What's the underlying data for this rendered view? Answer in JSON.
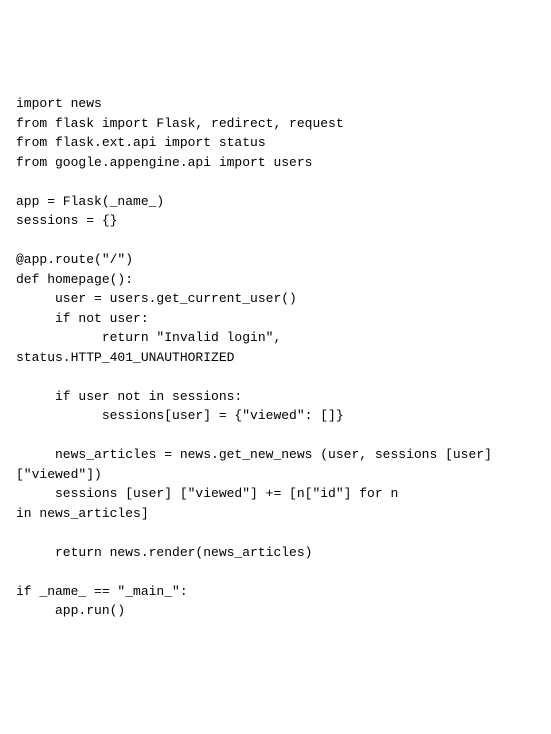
{
  "code": {
    "lines": [
      "import news",
      "from flask import Flask, redirect, request",
      "from flask.ext.api import status",
      "from google.appengine.api import users",
      "",
      "app = Flask(_name_)",
      "sessions = {}",
      "",
      "@app.route(\"/\")",
      "def homepage():",
      "     user = users.get_current_user()",
      "     if not user:",
      "           return \"Invalid login\",",
      "status.HTTP_401_UNAUTHORIZED",
      "",
      "     if user not in sessions:",
      "           sessions[user] = {\"viewed\": []}",
      "",
      "     news_articles = news.get_new_news (user, sessions [user]",
      "[\"viewed\"])",
      "     sessions [user] [\"viewed\"] += [n[\"id\"] for n",
      "in news_articles]",
      "",
      "     return news.render(news_articles)",
      "",
      "if _name_ == \"_main_\":",
      "     app.run()"
    ]
  }
}
